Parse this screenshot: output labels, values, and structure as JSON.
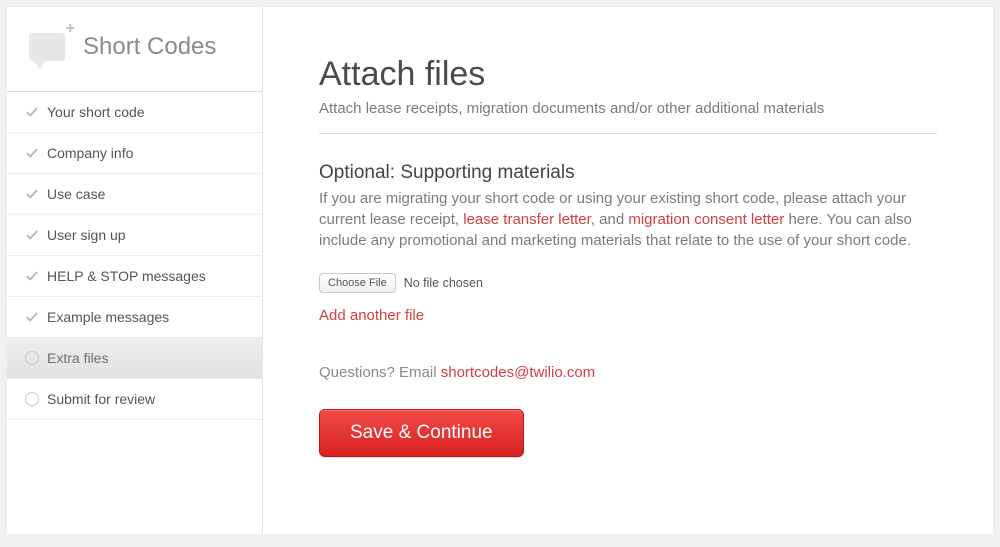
{
  "sidebar": {
    "title": "Short Codes",
    "items": [
      {
        "label": "Your short code",
        "state": "done"
      },
      {
        "label": "Company info",
        "state": "done"
      },
      {
        "label": "Use case",
        "state": "done"
      },
      {
        "label": "User sign up",
        "state": "done"
      },
      {
        "label": "HELP & STOP messages",
        "state": "done"
      },
      {
        "label": "Example messages",
        "state": "done"
      },
      {
        "label": "Extra files",
        "state": "active"
      },
      {
        "label": "Submit for review",
        "state": "pending"
      }
    ]
  },
  "main": {
    "title": "Attach files",
    "subtitle": "Attach lease receipts, migration documents and/or other additional materials",
    "section_heading": "Optional: Supporting materials",
    "body_pre": "If you are migrating your short code or using your existing short code, please attach your current lease receipt, ",
    "link1": "lease transfer letter",
    "body_mid": ", and ",
    "link2": "migration consent letter",
    "body_post": " here. You can also include any promotional and marketing materials that relate to the use of your short code.",
    "choose_file_label": "Choose File",
    "file_status": "No file chosen",
    "add_another": "Add another file",
    "questions_prefix": "Questions? Email ",
    "questions_email": "shortcodes@twilio.com",
    "save_label": "Save & Continue"
  }
}
